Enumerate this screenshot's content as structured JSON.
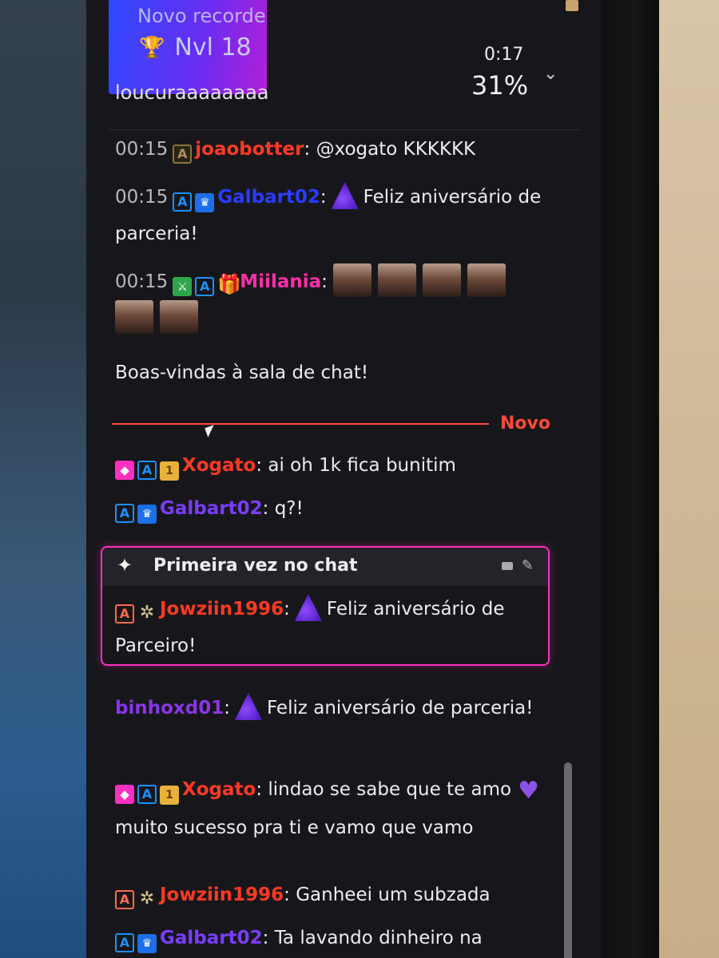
{
  "record_banner": {
    "label": "Novo recorde",
    "level": "Nvl 18",
    "trophy_icon": "trophy-icon"
  },
  "hype": {
    "timer": "0:17",
    "percent": "31%"
  },
  "top_message": "loucuraaaaaaaa",
  "divider_label": "Novo",
  "first_time_title": "Primeira vez no chat",
  "messages": [
    {
      "time": "00:15",
      "user": "joaobotter",
      "sep": ":",
      "text": "@xogato KKKKKK"
    },
    {
      "time": "00:15",
      "user": "Galbart02",
      "sep": ":",
      "text": "Feliz aniversário de parceria!"
    },
    {
      "time": "00:15",
      "user": "Miilania",
      "sep": ":"
    },
    {
      "text": "Boas-vindas à sala de chat!"
    },
    {
      "user": "Xogato",
      "sep": ":",
      "text": "ai oh 1k fica bunitim"
    },
    {
      "user": "Galbart02",
      "sep": ":",
      "text": "q?!"
    },
    {
      "user": "Jowziin1996",
      "sep": ":",
      "text": "Feliz aniversário de Parceiro!"
    },
    {
      "user": "binhoxd01",
      "sep": ":",
      "text": "Feliz aniversário de parceria!"
    },
    {
      "user": "Xogato",
      "sep": ":",
      "text_a": "lindao se sabe que te amo",
      "text_b": "muito sucesso pra ti e vamo que vamo"
    },
    {
      "user": "Jowziin1996",
      "sep": ":",
      "text": "Ganheei um subzada"
    },
    {
      "user": "Galbart02",
      "sep": ":",
      "text": "Ta lavando dinheiro na"
    }
  ],
  "colors": {
    "accent_red": "#ff4a3a",
    "highlight_pink": "#ff2fbf",
    "panel": "#17171b"
  }
}
